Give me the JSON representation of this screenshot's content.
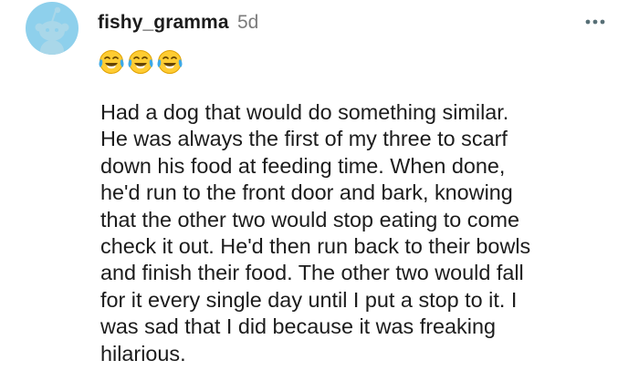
{
  "comment": {
    "username": "fishy_gramma",
    "age": "5d",
    "reaction_emojis": [
      "face-with-tears-of-joy",
      "face-with-tears-of-joy",
      "face-with-tears-of-joy"
    ],
    "body_lines": [
      "Had a dog that would do something similar.",
      "He was always the first of my three to scarf",
      "down his food at feeding time. When done,",
      "he'd run to the front door and bark, knowing",
      "that the other two would stop eating to come",
      "check it out. He'd then run back to their bowls",
      "and finish their food. The other two would fall",
      "for it every single day until I put a stop to it. I",
      "was sad that I did because it was freaking",
      "hilarious."
    ]
  },
  "icons": {
    "avatar": "snoo-avatar-icon",
    "more": "more-options-icon"
  },
  "colors": {
    "avatar_bg": "#8ed0ec",
    "text": "#1c1c1c",
    "muted": "#7c7c7c"
  }
}
